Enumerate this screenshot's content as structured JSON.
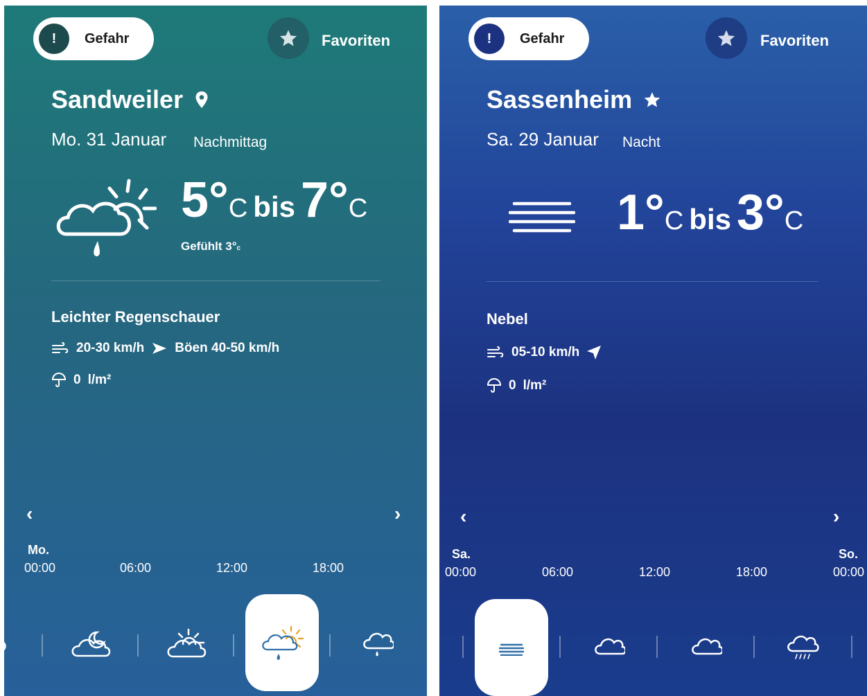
{
  "left": {
    "warning_label": "Gefahr",
    "warning_icon": "!",
    "favorites_label": "Favoriten",
    "city": "Sandweiler",
    "city_icon": "location-pin-icon",
    "date": "Mo. 31 Januar",
    "period": "Nachmittag",
    "temp_min": "5°",
    "temp_max": "7°",
    "temp_unit": "C",
    "temp_sep": "bis",
    "feels_label": "Gefühlt",
    "feels_value": "3°",
    "feels_unit": "c",
    "condition": "Leichter Regenschauer",
    "wind": "20-30 km/h",
    "gusts": "Böen 40-50 km/h",
    "rain": "0",
    "rain_unit": "l/m²",
    "day_label": "Mo.",
    "hours": [
      "00:00",
      "06:00",
      "12:00",
      "18:00"
    ],
    "accent": "#1e7a78"
  },
  "right": {
    "warning_label": "Gefahr",
    "warning_icon": "!",
    "favorites_label": "Favoriten",
    "city": "Sassenheim",
    "city_icon": "star-icon",
    "date": "Sa. 29 Januar",
    "period": "Nacht",
    "temp_min": "1°",
    "temp_max": "3°",
    "temp_unit": "C",
    "temp_sep": "bis",
    "condition": "Nebel",
    "wind": "05-10 km/h",
    "rain": "0",
    "rain_unit": "l/m²",
    "day_label_start": "Sa.",
    "day_label_end": "So.",
    "hours": [
      "00:00",
      "06:00",
      "12:00",
      "18:00",
      "00:00"
    ],
    "accent": "#22449a"
  },
  "nav": {
    "prev": "‹",
    "next": "›"
  }
}
